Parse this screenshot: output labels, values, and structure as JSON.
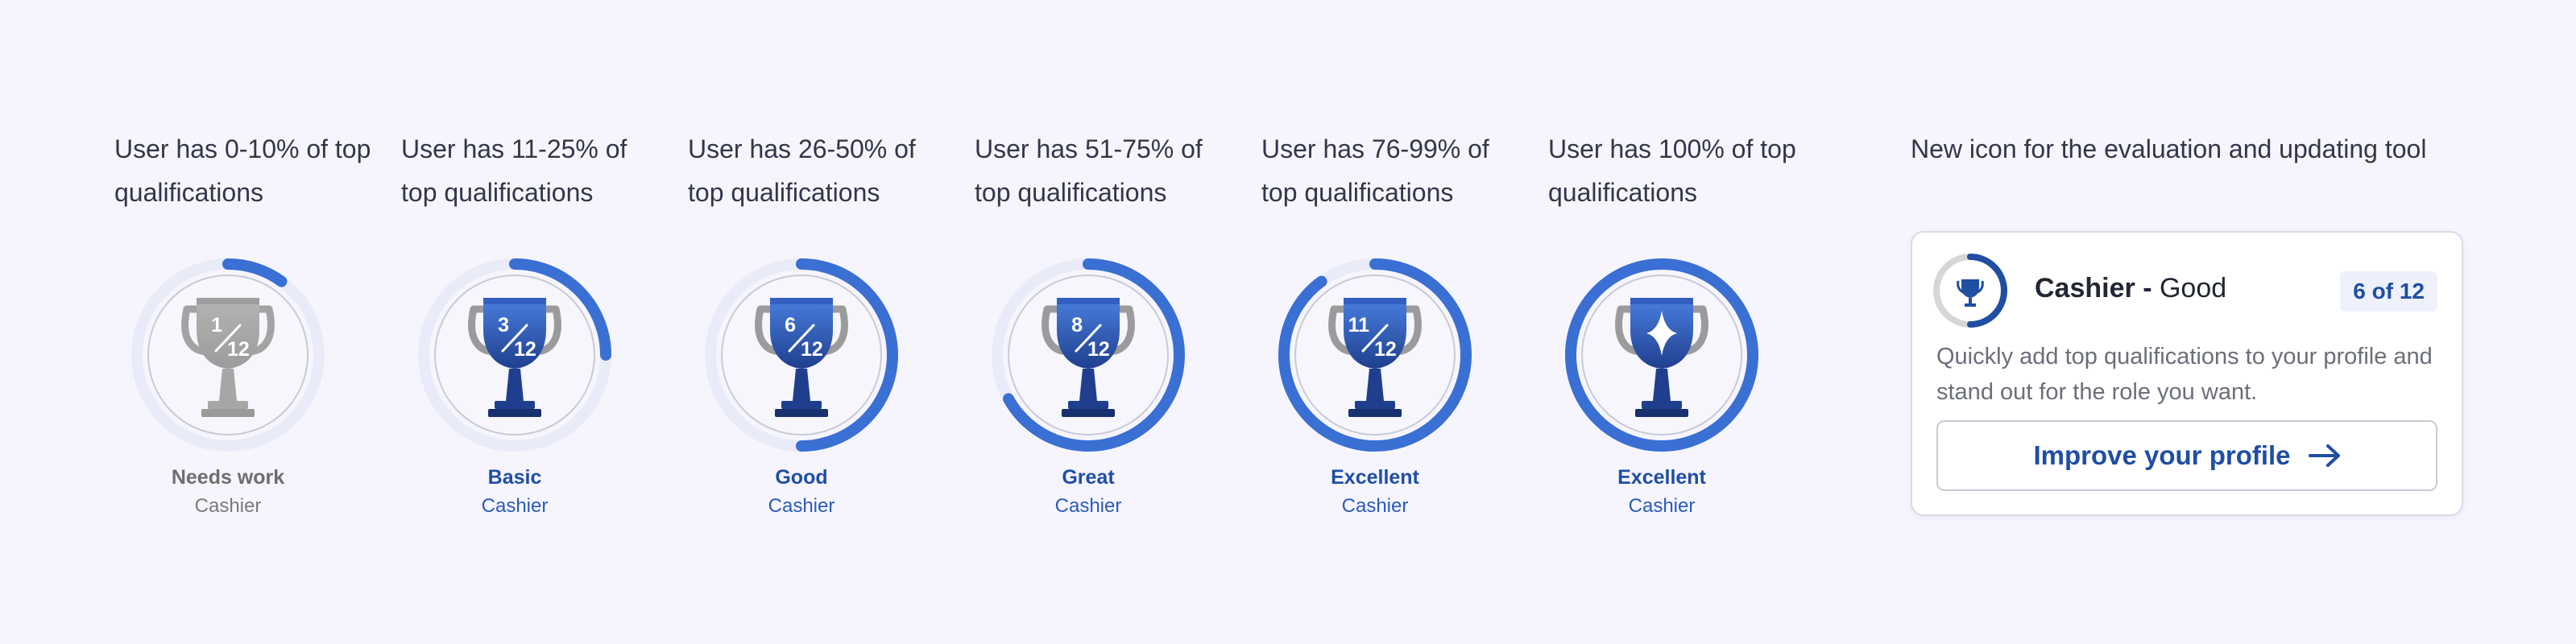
{
  "levels": [
    {
      "caption": "User has 0-10% of top qualifications",
      "label": "Needs work",
      "role": "Cashier",
      "count": "1",
      "total": "12",
      "progress": 0.1,
      "theme": "gray",
      "icon": "trophy-icon"
    },
    {
      "caption": "User has 11-25% of top qualifications",
      "label": "Basic",
      "role": "Cashier",
      "count": "3",
      "total": "12",
      "progress": 0.25,
      "theme": "blue",
      "icon": "trophy-icon"
    },
    {
      "caption": "User has 26-50% of top qualifications",
      "label": "Good",
      "role": "Cashier",
      "count": "6",
      "total": "12",
      "progress": 0.5,
      "theme": "blue",
      "icon": "trophy-icon"
    },
    {
      "caption": "User has 51-75% of top qualifications",
      "label": "Great",
      "role": "Cashier",
      "count": "8",
      "total": "12",
      "progress": 0.67,
      "theme": "blue",
      "icon": "trophy-icon"
    },
    {
      "caption": "User has 76-99% of top qualifications",
      "label": "Excellent",
      "role": "Cashier",
      "count": "11",
      "total": "12",
      "progress": 0.9,
      "theme": "blue",
      "icon": "trophy-icon"
    },
    {
      "caption": "User has 100% of top qualifications",
      "label": "Excellent",
      "role": "Cashier",
      "count": "",
      "total": "",
      "progress": 1.0,
      "theme": "blue",
      "icon": "trophy-sparkle-icon"
    }
  ],
  "new_icon": {
    "caption": "New icon for the evaluation and updating tool",
    "card": {
      "role": "Cashier",
      "separator": "-",
      "level": "Good",
      "count_text": "6 of 12",
      "progress": 0.5,
      "description": "Quickly add top qualifications to your profile and stand out for the role you want.",
      "button_label": "Improve your profile",
      "button_icon": "arrow-right-icon"
    }
  },
  "colors": {
    "background": "#f6f5fe",
    "accent": "#3a6fd4",
    "accent_dark": "#1f4ea3",
    "gray_trophy": "#a6a6a6",
    "track": "#e9ecf8"
  }
}
